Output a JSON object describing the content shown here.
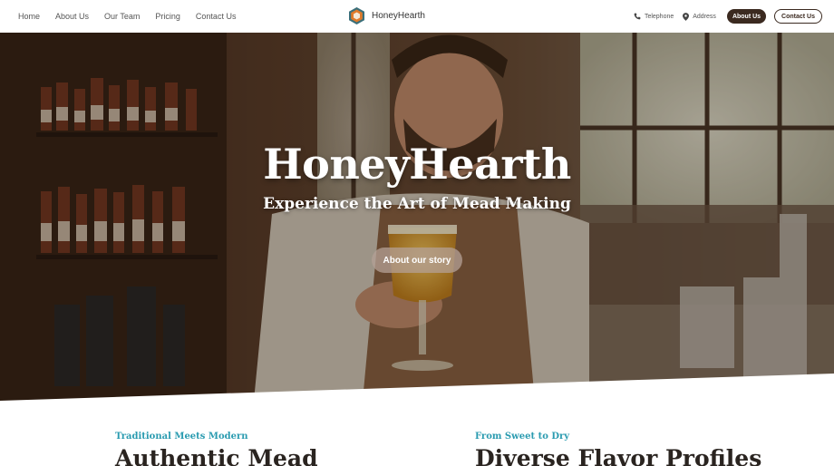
{
  "nav": {
    "links": [
      "Home",
      "About Us",
      "Our Team",
      "Pricing",
      "Contact Us"
    ],
    "brand": "HoneyHearth",
    "telephone": "Telephone",
    "address": "Address",
    "about_btn": "About Us",
    "contact_btn": "Contact Us"
  },
  "hero": {
    "title": "HoneyHearth",
    "subtitle": "Experience the Art of Mead Making",
    "cta": "About our story"
  },
  "features": [
    {
      "eyebrow": "Traditional Meets Modern",
      "heading": "Authentic Mead"
    },
    {
      "eyebrow": "From Sweet to Dry",
      "heading": "Diverse Flavor Profiles"
    }
  ],
  "colors": {
    "accent": "#2a9bb0",
    "brand_dark": "#3b2a20"
  },
  "icons": {
    "telephone": "phone-icon",
    "address": "map-pin-icon",
    "logo": "hexagon-logo-icon"
  }
}
